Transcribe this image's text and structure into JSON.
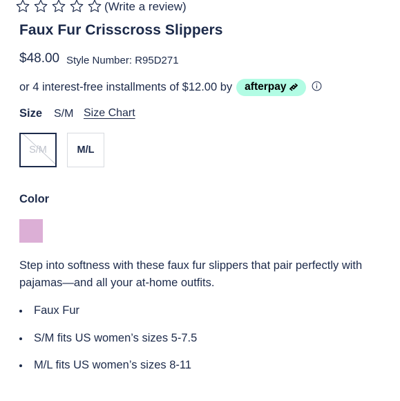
{
  "rating": {
    "star_count": 5,
    "review_link": "(Write a review)"
  },
  "product": {
    "title": "Faux Fur Crisscross Slippers",
    "price": "$48.00",
    "style_number": "Style Number: R95D271"
  },
  "afterpay": {
    "text": "or 4 interest-free installments of $12.00 by",
    "badge_label": "afterpay",
    "badge_color": "#b2fce4",
    "icon": "info-icon"
  },
  "size": {
    "label": "Size",
    "selected_value": "S/M",
    "chart_link": "Size Chart",
    "options": [
      {
        "label": "S/M",
        "state": "selected, unavailable"
      },
      {
        "label": "M/L",
        "state": "available"
      }
    ]
  },
  "color": {
    "label": "Color",
    "swatch_color": "#dcafd6"
  },
  "description": {
    "text": "Step into softness with these faux fur slippers that pair perfectly with pajamas—and all your at-home outfits.",
    "bullets": [
      "Faux Fur",
      "S/M fits US women’s sizes 5-7.5",
      "M/L fits US women’s sizes 8-11"
    ]
  },
  "colors": {
    "text": "#1c2a4a",
    "selected_border": "#1c2a4a",
    "unselected_border": "#d7dadf"
  }
}
